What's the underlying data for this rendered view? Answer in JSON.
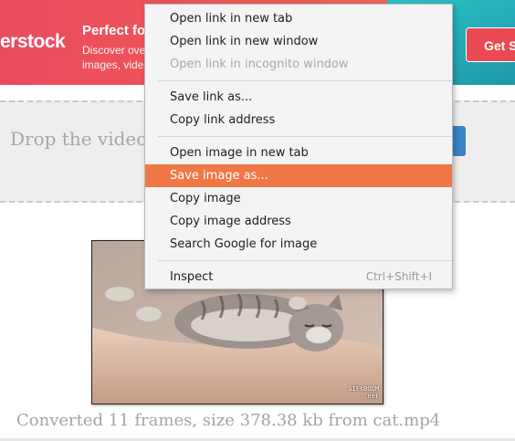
{
  "banner": {
    "logo": "erstock",
    "headline": "Perfect fo",
    "sub_line1": "Discover ove",
    "sub_line2": "images, vide",
    "cta": "Get S"
  },
  "dropzone": {
    "text": "Drop the video"
  },
  "gif": {
    "watermark_line1": "GIFsBOOM",
    "watermark_line2": ".net"
  },
  "caption": "Converted 11 frames, size 378.38 kb from cat.mp4",
  "context_menu": {
    "items": [
      {
        "label": "Open link in new tab"
      },
      {
        "label": "Open link in new window"
      },
      {
        "label": "Open link in incognito window",
        "disabled": true
      },
      {
        "label": "Save link as..."
      },
      {
        "label": "Copy link address"
      },
      {
        "label": "Open image in new tab"
      },
      {
        "label": "Save image as...",
        "highlighted": true
      },
      {
        "label": "Copy image"
      },
      {
        "label": "Copy image address"
      },
      {
        "label": "Search Google for image"
      },
      {
        "label": "Inspect",
        "shortcut": "Ctrl+Shift+I"
      }
    ]
  },
  "colors": {
    "highlight": "#f07846",
    "banner_red": "#ea4c5f",
    "banner_teal": "#2bc0c6",
    "drop_button": "#3a84c9"
  }
}
